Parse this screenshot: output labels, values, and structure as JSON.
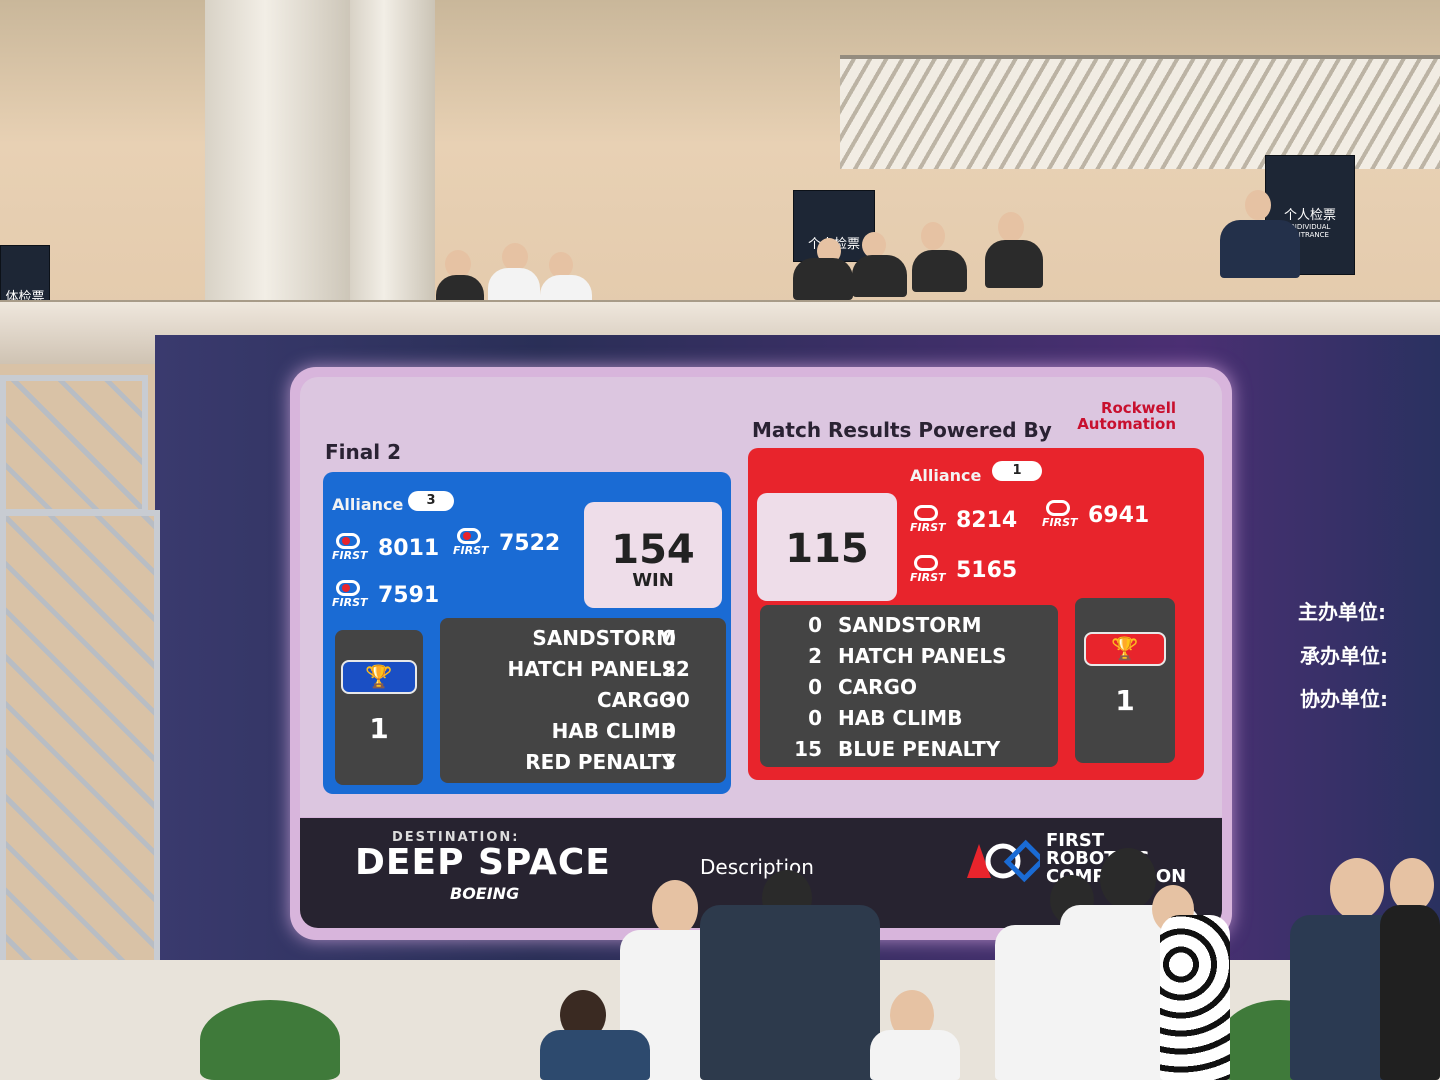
{
  "scoreboard": {
    "match_label": "Final 2",
    "powered_by": "Match Results Powered By",
    "sponsor_line1": "Rockwell",
    "sponsor_line2": "Automation",
    "blue": {
      "alliance_label": "Alliance",
      "alliance_number": "3",
      "teams": [
        "8011",
        "7522",
        "7591"
      ],
      "score": "154",
      "result": "WIN",
      "rank": "1",
      "stats": [
        {
          "label": "SANDSTORM",
          "value": "0"
        },
        {
          "label": "HATCH PANELS",
          "value": "22"
        },
        {
          "label": "CARGO",
          "value": "30"
        },
        {
          "label": "HAB CLIMB",
          "value": "0"
        },
        {
          "label": "RED PENALTY",
          "value": "3"
        }
      ]
    },
    "red": {
      "alliance_label": "Alliance",
      "alliance_number": "1",
      "teams": [
        "8214",
        "6941",
        "5165"
      ],
      "score": "115",
      "rank": "1",
      "stats": [
        {
          "label": "SANDSTORM",
          "value": "0"
        },
        {
          "label": "HATCH PANELS",
          "value": "2"
        },
        {
          "label": "CARGO",
          "value": "0"
        },
        {
          "label": "HAB CLIMB",
          "value": "0"
        },
        {
          "label": "BLUE PENALTY",
          "value": "15"
        }
      ]
    },
    "first_logo_text": "FIRST",
    "footer": {
      "destination": "DESTINATION:",
      "game_name": "DEEP SPACE",
      "presenter": "BOEING",
      "description": "Description",
      "frc_line1": "FIRST",
      "frc_line2": "ROBOTICS",
      "frc_line3": "COMPETITION"
    }
  },
  "side_screen": {
    "organizer_label": "主办单位:",
    "host_label": "承办单位:",
    "co_organizer_label": "协办单位:"
  },
  "balcony_signs": {
    "left_sign": "体检票",
    "center_sign": "个人检票",
    "right_sign": "个人检票",
    "right_sign_en1": "INDIVIDUAL",
    "right_sign_en2": "ENTRANCE"
  },
  "colors": {
    "blue_alliance": "#1a6bd4",
    "red_alliance": "#e8242c",
    "board_frame": "#d8b5dc"
  }
}
